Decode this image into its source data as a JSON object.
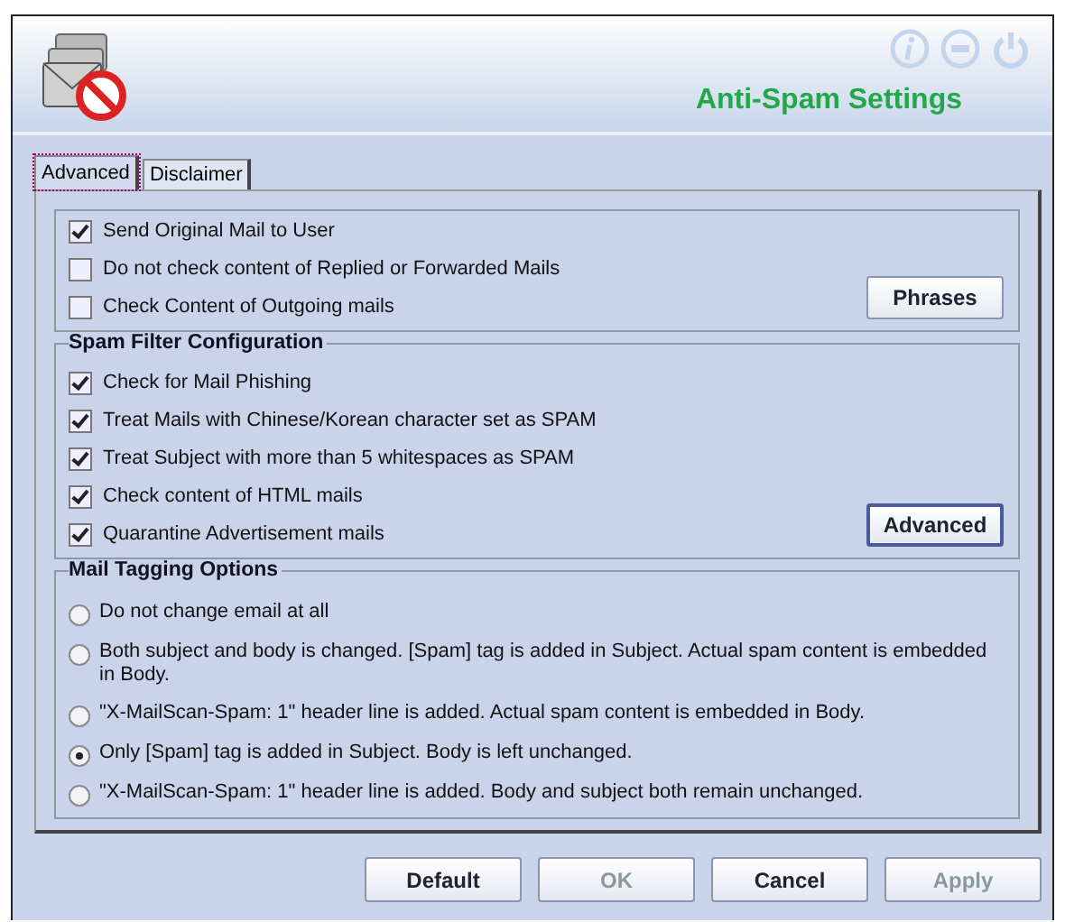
{
  "header": {
    "title": "Anti-Spam Settings"
  },
  "tabs": [
    {
      "label": "Advanced",
      "selected": true
    },
    {
      "label": "Disclaimer",
      "selected": false
    }
  ],
  "general": {
    "options": [
      {
        "label": "Send Original Mail to User",
        "checked": true
      },
      {
        "label": "Do not check content of Replied or Forwarded Mails",
        "checked": false
      },
      {
        "label": "Check Content of Outgoing mails",
        "checked": false
      }
    ],
    "button": "Phrases"
  },
  "spam_filter": {
    "title": "Spam Filter Configuration",
    "options": [
      {
        "label": "Check for Mail Phishing",
        "checked": true
      },
      {
        "label": "Treat Mails with Chinese/Korean character set as SPAM",
        "checked": true
      },
      {
        "label": "Treat Subject with more than 5 whitespaces as SPAM",
        "checked": true
      },
      {
        "label": "Check content of HTML mails",
        "checked": true
      },
      {
        "label": "Quarantine Advertisement mails",
        "checked": true
      }
    ],
    "button": "Advanced"
  },
  "tagging": {
    "title": "Mail Tagging Options",
    "options": [
      {
        "label": "Do not change email at all",
        "selected": false
      },
      {
        "label": "Both subject and body is changed.  [Spam] tag is added in Subject. Actual spam content is embedded in Body.",
        "selected": false
      },
      {
        "label": "\"X-MailScan-Spam: 1\" header line is added.  Actual spam content is embedded in Body.",
        "selected": false
      },
      {
        "label": "Only [Spam] tag is added in Subject. Body is left unchanged.",
        "selected": true
      },
      {
        "label": "\"X-MailScan-Spam: 1\" header line is added.  Body and subject both remain unchanged.",
        "selected": false
      }
    ]
  },
  "buttons": [
    {
      "label": "Default",
      "disabled": false
    },
    {
      "label": "OK",
      "disabled": true
    },
    {
      "label": "Cancel",
      "disabled": false
    },
    {
      "label": "Apply",
      "disabled": true
    }
  ]
}
